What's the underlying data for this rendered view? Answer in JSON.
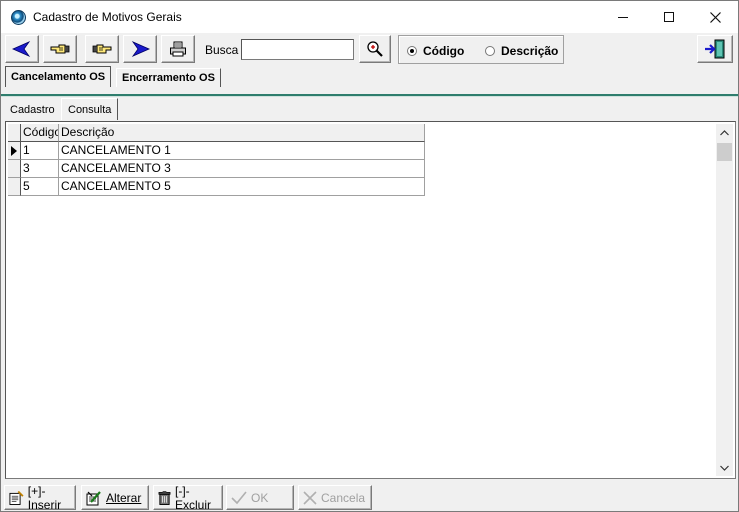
{
  "window": {
    "title": "Cadastro de Motivos Gerais",
    "controls": {
      "minimize": "–",
      "maximize": "□",
      "close": "✕"
    }
  },
  "toolbar": {
    "buttons": [
      {
        "name": "prev",
        "icon": "arrow-left-icon"
      },
      {
        "name": "first",
        "icon": "hand-point-left-icon"
      },
      {
        "name": "last",
        "icon": "hand-point-right-icon"
      },
      {
        "name": "next",
        "icon": "arrow-right-icon"
      },
      {
        "name": "print",
        "icon": "printer-icon"
      }
    ],
    "search_label": "Busca",
    "search_value": "",
    "search_icon": "magnifier-zoom-icon",
    "radio": {
      "options": [
        "Código",
        "Descrição"
      ],
      "selected": "Código"
    },
    "exit_icon": "exit-door-icon"
  },
  "outer_tabs": [
    "Cancelamento OS",
    "Encerramento OS"
  ],
  "outer_active_tab": "Cancelamento OS",
  "inner_tabs": [
    "Cadastro",
    "Consulta"
  ],
  "inner_active_tab": "Consulta",
  "grid": {
    "columns": [
      "Código",
      "Descrição"
    ],
    "rows": [
      {
        "codigo": "1",
        "descricao": "CANCELAMENTO 1"
      },
      {
        "codigo": "3",
        "descricao": "CANCELAMENTO 3"
      },
      {
        "codigo": "5",
        "descricao": "CANCELAMENTO 5"
      }
    ],
    "current_row": 0
  },
  "bottom_buttons": {
    "inserir": {
      "label": "[+]-Inserir",
      "enabled": true
    },
    "alterar": {
      "label": "Alterar",
      "enabled": true
    },
    "excluir": {
      "label": "[-]-Excluir",
      "enabled": true
    },
    "ok": {
      "label": "OK",
      "enabled": false
    },
    "cancela": {
      "label": "Cancela",
      "enabled": false
    }
  },
  "colors": {
    "accent_blue": "#1a1acc",
    "teal_divider": "#2f7d6d",
    "grid_line": "#a0a0a0"
  }
}
